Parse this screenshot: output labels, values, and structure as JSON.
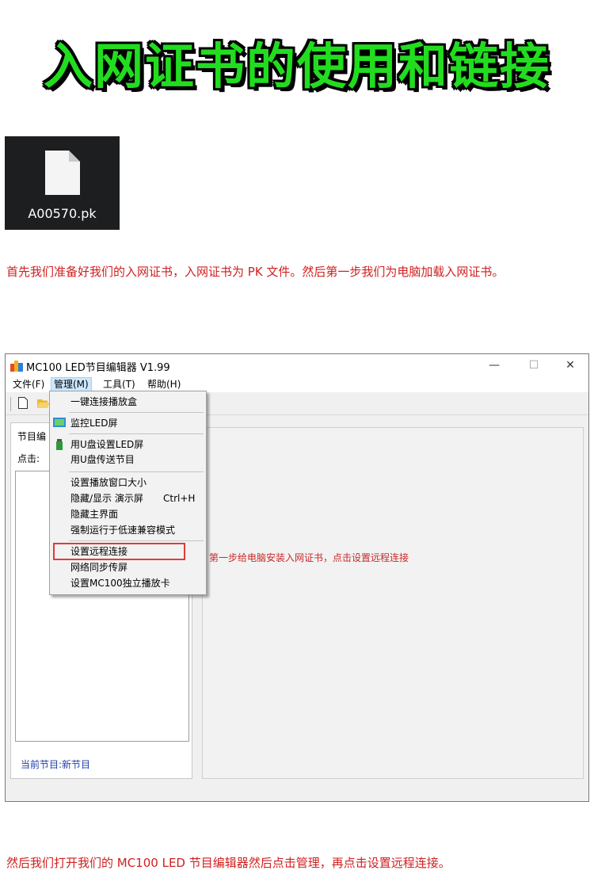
{
  "title": "入网证书的使用和链接",
  "file": {
    "name": "A00570.pk"
  },
  "paragraph1": "首先我们准备好我们的入网证书，入网证书为 PK 文件。然后第一步我们为电脑加载入网证书。",
  "window": {
    "title": "MC100 LED节目编辑器 V1.99",
    "controls": {
      "minimize": "—",
      "maximize": "☐",
      "close": "✕"
    },
    "menu": [
      "文件(F)",
      "管理(M)",
      "工具(T)",
      "帮助(H)"
    ],
    "left_panel": {
      "tab": "节目编",
      "click_label": "点击:",
      "status": "当前节目:新节目"
    },
    "annotation": "第一步给电脑安装入网证书，点击设置远程连接",
    "dropdown": {
      "items": [
        {
          "label": "一键连接播放盒",
          "shortcut": ""
        },
        {
          "label": "监控LED屏",
          "shortcut": ""
        },
        {
          "label": "用U盘设置LED屏",
          "shortcut": ""
        },
        {
          "label": "用U盘传送节目",
          "shortcut": ""
        },
        {
          "label": "设置播放窗口大小",
          "shortcut": ""
        },
        {
          "label": "隐藏/显示 演示屏",
          "shortcut": "Ctrl+H"
        },
        {
          "label": "隐藏主界面",
          "shortcut": ""
        },
        {
          "label": "强制运行于低速兼容模式",
          "shortcut": ""
        },
        {
          "label": "设置远程连接",
          "shortcut": ""
        },
        {
          "label": "网络同步传屏",
          "shortcut": ""
        },
        {
          "label": "设置MC100独立播放卡",
          "shortcut": ""
        }
      ]
    }
  },
  "paragraph2": "然后我们打开我们的 MC100 LED 节目编辑器然后点击管理，再点击设置远程连接。",
  "colors": {
    "title_green": "#22dd1f",
    "text_red": "#d11f1f",
    "highlight_red": "#e23b3b",
    "status_blue": "#1f3fa8"
  }
}
